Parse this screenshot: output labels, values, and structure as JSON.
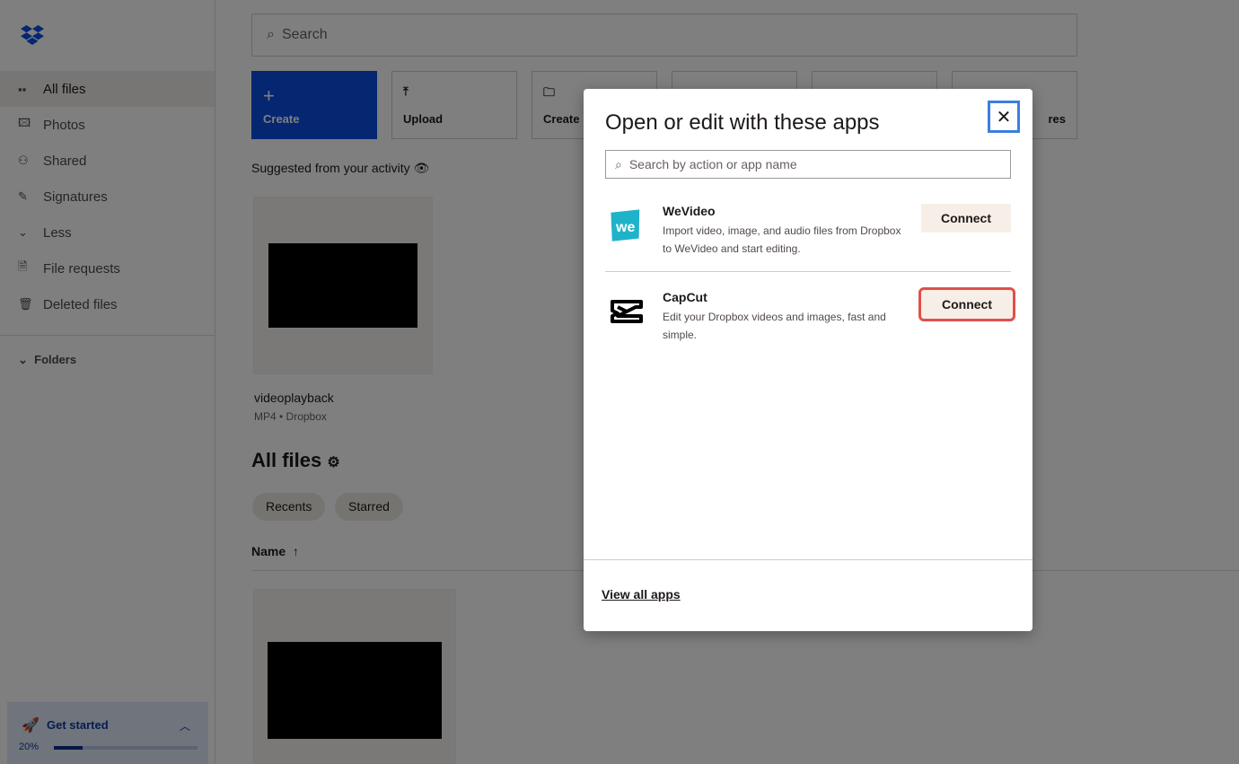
{
  "sidebar": {
    "items": [
      {
        "label": "All files",
        "icon": "grid-icon",
        "glyph": "▪▪"
      },
      {
        "label": "Photos",
        "icon": "photo-icon",
        "glyph": "🖾"
      },
      {
        "label": "Shared",
        "icon": "shared-icon",
        "glyph": "⚇"
      },
      {
        "label": "Signatures",
        "icon": "signature-icon",
        "glyph": "✎"
      },
      {
        "label": "Less",
        "icon": "chevron-down-icon",
        "glyph": "⌄"
      },
      {
        "label": "File requests",
        "icon": "file-request-icon",
        "glyph": "🗎"
      },
      {
        "label": "Deleted files",
        "icon": "trash-icon",
        "glyph": "🗑"
      }
    ],
    "folders": "Folders",
    "get_started": {
      "label": "Get started",
      "percent_label": "20%",
      "progress": 20
    }
  },
  "main": {
    "search_placeholder": "Search",
    "tiles": [
      {
        "label": "Create",
        "glyph": "+"
      },
      {
        "label": "Upload",
        "glyph": "⤒"
      },
      {
        "label": "Create",
        "glyph": "🗀"
      },
      {
        "label": "",
        "glyph": ""
      },
      {
        "label": "",
        "glyph": ""
      },
      {
        "label": "res",
        "glyph": ""
      }
    ],
    "suggested": "Suggested from your activity",
    "suggested_file": {
      "name": "videoplayback",
      "meta": "MP4 • Dropbox"
    },
    "all_files": "All files",
    "chips": [
      "Recents",
      "Starred"
    ],
    "name_col": "Name"
  },
  "modal": {
    "title": "Open or edit with these apps",
    "search_placeholder": "Search by action or app name",
    "apps": [
      {
        "name": "WeVideo",
        "desc": "Import video, image, and audio files from Dropbox to WeVideo and start editing.",
        "button": "Connect"
      },
      {
        "name": "CapCut",
        "desc": "Edit your Dropbox videos and images, fast and simple.",
        "button": "Connect"
      }
    ],
    "view_all": "View all apps"
  }
}
